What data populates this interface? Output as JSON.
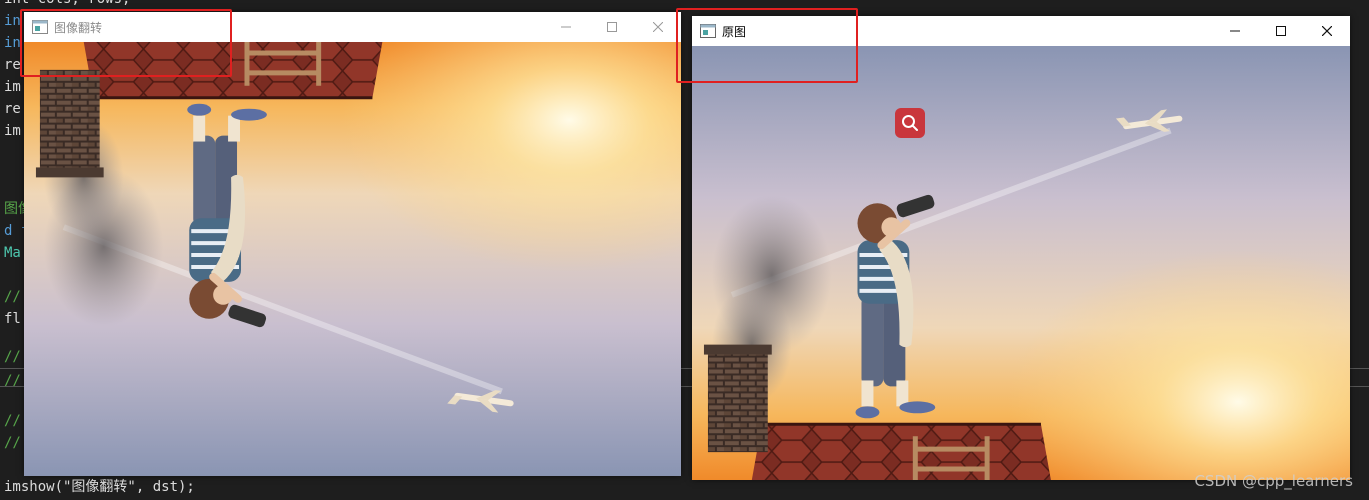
{
  "editor": {
    "lines": [
      "int cols, rows;",
      "in",
      "in",
      "re",
      "im",
      "re",
      "im",
      "",
      "图像",
      "d f",
      "Ma",
      "",
      "//",
      "fl",
      "",
      "//",
      "//",
      "",
      "//",
      "//",
      "",
      "imshow(\"图像翻转\", dst);"
    ]
  },
  "windows": {
    "flipped": {
      "title": "图像翻转"
    },
    "original": {
      "title": "原图"
    }
  },
  "window_controls": {
    "minimize": "minimize-icon",
    "maximize": "maximize-icon",
    "close": "close-icon"
  },
  "overlay": {
    "search_icon": "search-icon",
    "watermark": "CSDN @cpp_learners"
  },
  "colors": {
    "highlight": "#e02020",
    "search_badge": "#c9363c",
    "editor_bg": "#1e1e1e"
  }
}
